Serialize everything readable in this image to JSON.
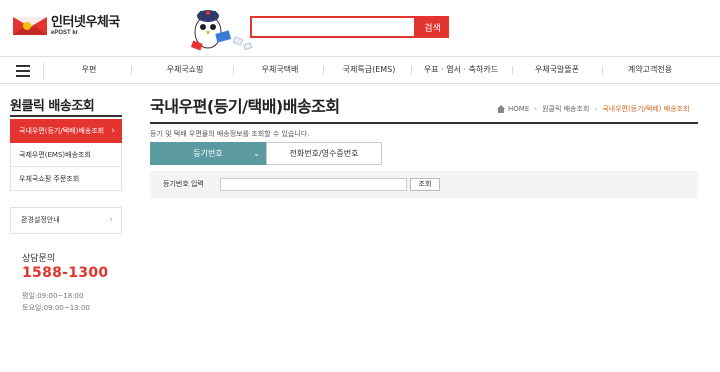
{
  "brand": {
    "title": "인터넷우체국",
    "sub": "ePOST kr"
  },
  "search": {
    "value": "",
    "button_label": "검색"
  },
  "nav": {
    "items": [
      "우편",
      "우체국쇼핑",
      "우체국택배",
      "국제특급(EMS)",
      "우표 · 엽서 · 축하카드",
      "우체국알뜰폰",
      "계약고객전용"
    ]
  },
  "sidebar": {
    "title": "원클릭 배송조회",
    "items": [
      {
        "label": "국내우편(등기/택배)배송조회",
        "active": true
      },
      {
        "label": "국제우편(EMS)배송조회",
        "active": false
      },
      {
        "label": "우체국쇼핑 주문조회",
        "active": false
      }
    ],
    "env_label": "환경설정안내",
    "cs_label": "상담문의",
    "cs_phone": "1588-1300",
    "cs_hours": [
      "평일:09:00~18:00",
      "토요일:09:00~13:00"
    ]
  },
  "main": {
    "title": "국내우편(등기/택배)배송조회",
    "breadcrumb": [
      "HOME",
      "원클릭 배송조회",
      "국내우편(등기/택배) 배송조회"
    ],
    "description": "등기 및 택배 우편물의 배송정보를 조회할 수 있습니다.",
    "tabs": [
      "등기번호",
      "전화번호/영수증번호"
    ],
    "form_label": "등기번호 입력",
    "input_value": "",
    "submit_label": "조회"
  },
  "colors": {
    "accent": "#e3342f",
    "tab": "#5b9aa0",
    "breadcrumb_current": "#d2691e"
  }
}
